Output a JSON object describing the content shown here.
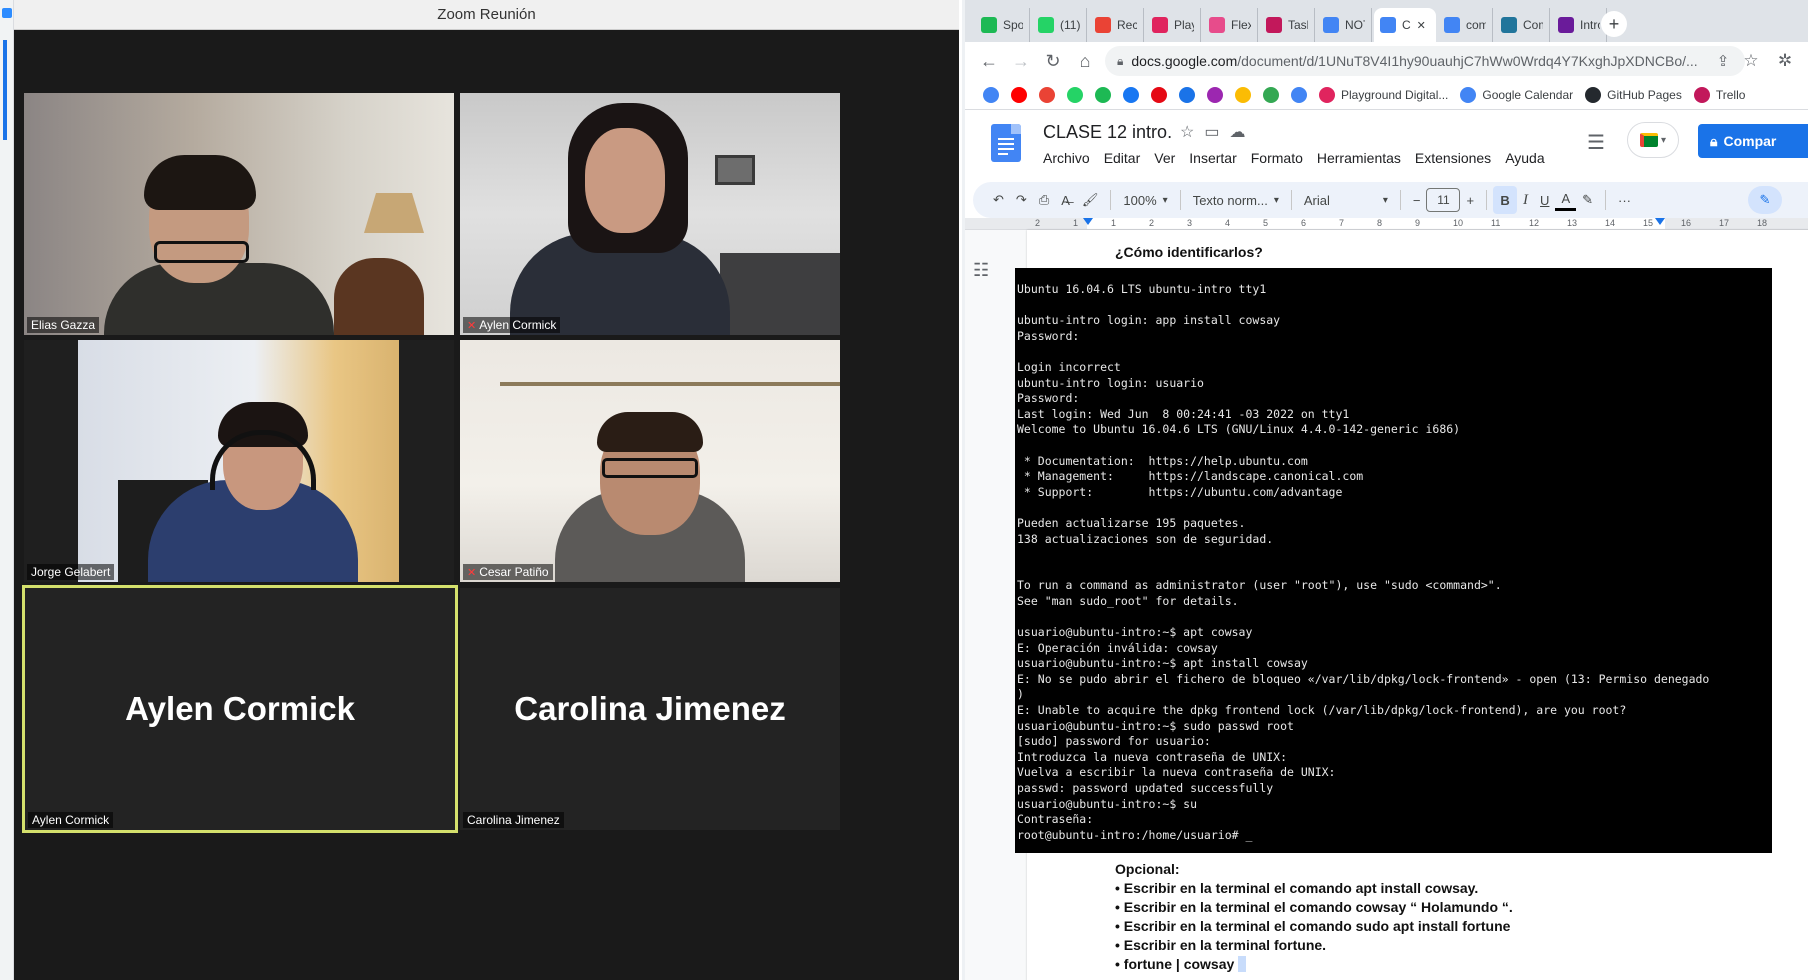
{
  "zoom": {
    "window_title": "Zoom Reunión",
    "participants": [
      {
        "name": "Elias Gazza",
        "muted": false
      },
      {
        "name": "Aylen Cormick",
        "muted": true
      },
      {
        "name": "Jorge Gelabert",
        "muted": false
      },
      {
        "name": "Cesar Patiño",
        "muted": true
      },
      {
        "name": "Aylen Cormick",
        "muted": false,
        "video_off": true,
        "active_speaker": true
      },
      {
        "name": "Carolina Jimenez",
        "muted": false,
        "video_off": true
      }
    ],
    "big_names": [
      "Aylen Cormick",
      "Carolina Jimenez"
    ]
  },
  "browser": {
    "tabs": [
      {
        "label": "Spot",
        "color": "#1db954"
      },
      {
        "label": "(11)",
        "color": "#25d366"
      },
      {
        "label": "Reci",
        "color": "#ea4335"
      },
      {
        "label": "Play",
        "color": "#e0245e"
      },
      {
        "label": "Flex",
        "color": "#e74c8b"
      },
      {
        "label": "Task",
        "color": "#c2185b"
      },
      {
        "label": "NOT",
        "color": "#4285f4"
      },
      {
        "label": "C",
        "color": "#4285f4",
        "active": true
      },
      {
        "label": "com",
        "color": "#4285f4"
      },
      {
        "label": "Com",
        "color": "#21759b"
      },
      {
        "label": "Intro",
        "color": "#6a1b9a"
      }
    ],
    "url_host": "docs.google.com",
    "url_path": "/document/d/1UNuT8V4I1hy90uauhjC7hWw0Wrdq4Y7KxghJpXDNCBo/...",
    "bookmarks": [
      {
        "label": "",
        "color": "#4285f4"
      },
      {
        "label": "",
        "color": "#ff0000"
      },
      {
        "label": "",
        "color": "#ea4335"
      },
      {
        "label": "",
        "color": "#25d366"
      },
      {
        "label": "",
        "color": "#1db954"
      },
      {
        "label": "",
        "color": "#1877f2"
      },
      {
        "label": "",
        "color": "#e50914"
      },
      {
        "label": "",
        "color": "#1a73e8"
      },
      {
        "label": "",
        "color": "#9c27b0"
      },
      {
        "label": "",
        "color": "#fbbc04"
      },
      {
        "label": "",
        "color": "#34a853"
      },
      {
        "label": "",
        "color": "#4285f4"
      },
      {
        "label": "Playground Digital...",
        "color": "#e0245e"
      },
      {
        "label": "Google Calendar",
        "color": "#4285f4"
      },
      {
        "label": "GitHub Pages",
        "color": "#24292e"
      },
      {
        "label": "Trello",
        "color": "#c2185b"
      }
    ]
  },
  "docs": {
    "title": "CLASE 12 intro.",
    "menu": [
      "Archivo",
      "Editar",
      "Ver",
      "Insertar",
      "Formato",
      "Herramientas",
      "Extensiones",
      "Ayuda"
    ],
    "share_label": "Compar",
    "toolbar": {
      "zoom": "100%",
      "style": "Texto norm...",
      "font": "Arial",
      "font_size": "11",
      "minus": "−",
      "plus": "+",
      "more": "···"
    },
    "ruler_numbers": [
      "2",
      "1",
      "1",
      "2",
      "3",
      "4",
      "5",
      "6",
      "7",
      "8",
      "9",
      "10",
      "11",
      "12",
      "13",
      "14",
      "15",
      "16",
      "17",
      "18"
    ],
    "question": "¿Cómo identificarlos?",
    "terminal_lines": [
      "Ubuntu 16.04.6 LTS ubuntu-intro tty1",
      "",
      "ubuntu-intro login: app install cowsay",
      "Password:",
      "",
      "Login incorrect",
      "ubuntu-intro login: usuario",
      "Password:",
      "Last login: Wed Jun  8 00:24:41 -03 2022 on tty1",
      "Welcome to Ubuntu 16.04.6 LTS (GNU/Linux 4.4.0-142-generic i686)",
      "",
      " * Documentation:  https://help.ubuntu.com",
      " * Management:     https://landscape.canonical.com",
      " * Support:        https://ubuntu.com/advantage",
      "",
      "Pueden actualizarse 195 paquetes.",
      "138 actualizaciones son de seguridad.",
      "",
      "",
      "To run a command as administrator (user \"root\"), use \"sudo <command>\".",
      "See \"man sudo_root\" for details.",
      "",
      "usuario@ubuntu-intro:~$ apt cowsay",
      "E: Operación inválida: cowsay",
      "usuario@ubuntu-intro:~$ apt install cowsay",
      "E: No se pudo abrir el fichero de bloqueo «/var/lib/dpkg/lock-frontend» - open (13: Permiso denegado",
      ")",
      "E: Unable to acquire the dpkg frontend lock (/var/lib/dpkg/lock-frontend), are you root?",
      "usuario@ubuntu-intro:~$ sudo passwd root",
      "[sudo] password for usuario:",
      "Introduzca la nueva contraseña de UNIX:",
      "Vuelva a escribir la nueva contraseña de UNIX:",
      "passwd: password updated successfully",
      "usuario@ubuntu-intro:~$ su",
      "Contraseña:",
      "root@ubuntu-intro:/home/usuario# _"
    ],
    "optional_title": "Opcional:",
    "optional_items": [
      "• Escribir en la terminal el comando apt install cowsay.",
      "• Escribir en la terminal el comando cowsay “ Holamundo “.",
      "• Escribir en la terminal el comando sudo apt install fortune",
      "• Escribir en la terminal fortune.",
      "• fortune | cowsay "
    ]
  }
}
